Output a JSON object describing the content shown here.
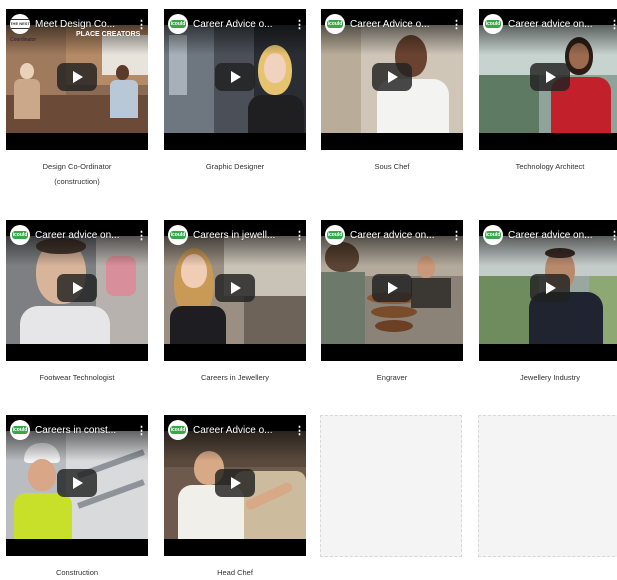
{
  "videos": [
    {
      "title": "Meet Design Co...",
      "caption_line1": "Design Co-Ordinator",
      "caption_line2": "(construction)",
      "logo": "THE NEST",
      "overlay": "PLACE CREATORS",
      "overlay2": "Coordinator"
    },
    {
      "title": "Career Advice o...",
      "caption_line1": "Graphic Designer",
      "logo": "icould"
    },
    {
      "title": "Career Advice o...",
      "caption_line1": "Sous Chef",
      "logo": "icould"
    },
    {
      "title": "Career advice on...",
      "caption_line1": "Technology Architect",
      "logo": "icould"
    },
    {
      "title": "Career advice on...",
      "caption_line1": "Footwear Technologist",
      "logo": "icould"
    },
    {
      "title": "Careers in jewell...",
      "caption_line1": "Careers in Jewellery",
      "logo": "icould"
    },
    {
      "title": "Career advice on...",
      "caption_line1": "Engraver",
      "logo": "icould"
    },
    {
      "title": "Career advice on...",
      "caption_line1": "Jewellery Industry",
      "logo": "icould"
    },
    {
      "title": "Careers in const...",
      "caption_line1": "Construction",
      "logo": "icould"
    },
    {
      "title": "Career Advice o...",
      "caption_line1": "Head Chef",
      "logo": "icould"
    }
  ],
  "menu_icon": "⋮",
  "accent": "#3aa64a",
  "play_button_color": "#212121"
}
